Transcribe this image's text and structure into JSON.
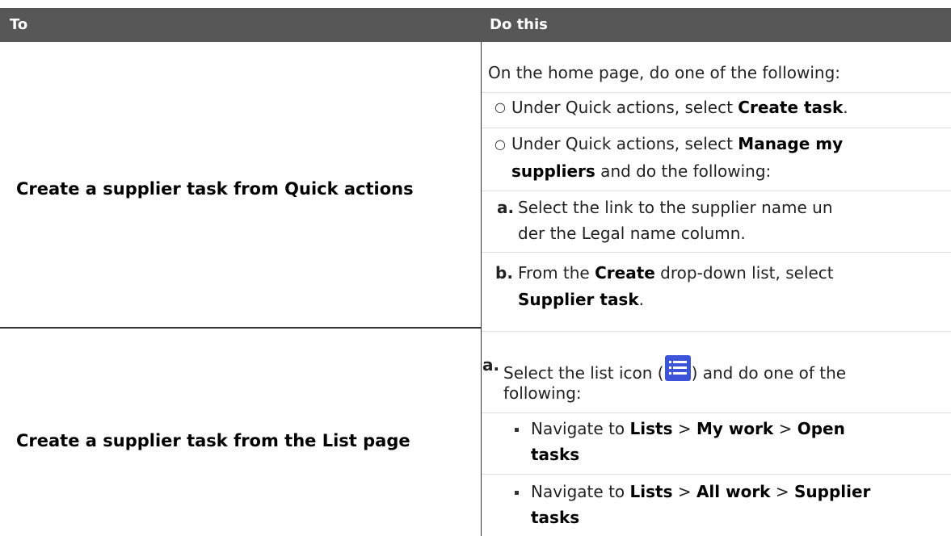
{
  "header": {
    "col1": "To",
    "col2": "Do this"
  },
  "rows": [
    {
      "label": "Create a supplier task from Quick actions",
      "intro": "On the home page, do one of the following:",
      "opt1": {
        "marker": "○",
        "pre": "Under Quick actions, select ",
        "bold": "Create task",
        "post": "."
      },
      "opt2": {
        "marker": "○",
        "line1_pre": "Under Quick actions, select ",
        "line1_bold": "Manage my",
        "line2_bold": "suppliers",
        "line2_post": " and do the following:"
      },
      "stepA": {
        "marker": "a.",
        "line1": "Select the link to the supplier name un",
        "line2": "der the Legal name column."
      },
      "stepB": {
        "marker": "b.",
        "line1_pre": "From the ",
        "line1_bold": "Create",
        "line1_post": " drop-down list, select",
        "line2_bold": "Supplier task",
        "line2_post": "."
      }
    },
    {
      "label": "Create a supplier task from the List page",
      "stepA": {
        "marker": "a.",
        "line1_pre": "Select the list icon (",
        "icon": "list-icon",
        "line1_post": ") and do one of the",
        "line2": "following:"
      },
      "bullet1": {
        "pre": "Navigate to ",
        "b1": "Lists",
        "sep1": " > ",
        "b2": "My work",
        "sep2": " > ",
        "b3": "Open",
        "line2_bold": "tasks"
      },
      "bullet2": {
        "pre": "Navigate to ",
        "b1": "Lists",
        "sep1": " > ",
        "b2": "All work",
        "sep2": " > ",
        "b3": "Supplier",
        "line2_bold": "tasks"
      }
    }
  ],
  "colors": {
    "header_bg": "#575757",
    "icon_blue": "#3b54d8"
  }
}
